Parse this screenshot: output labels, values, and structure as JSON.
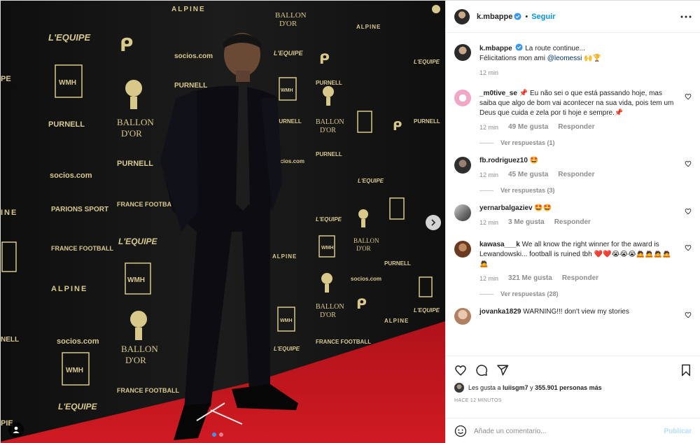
{
  "post": {
    "author": "k.mbappe",
    "verified": true,
    "follow_label": "Seguir",
    "separator": "•",
    "caption_line1": "La route continue...",
    "caption_line2_prefix": "Félicitations mon ami ",
    "caption_mention": "@leomessi",
    "caption_emoji": "🙌🏆",
    "caption_time": "12 min"
  },
  "photo": {
    "alt": "Ballon d'Or red carpet photo",
    "sponsors": [
      "L'EQUIPE",
      "WMH",
      "PURNELL",
      "BALLON D'OR",
      "FRANCE FOOTBALL",
      "socios.com",
      "ALPINE",
      "PARIONS SPORT"
    ],
    "carousel_dots": 2,
    "active_dot": 0
  },
  "comments": [
    {
      "user": "_m0tive_se",
      "prefix_emoji": "📌",
      "text": "Eu não sei o que está passando hoje, mas saiba que algo de bom vai acontecer na sua vida, pois tem um Deus que cuida e zela por ti hoje e sempre.",
      "suffix_emoji": "📌",
      "time": "12 min",
      "likes": "49 Me gusta",
      "reply": "Responder",
      "replies": "Ver respuestas (1)",
      "avatar_color": "#f4a6c8"
    },
    {
      "user": "fb.rodriguez10",
      "prefix_emoji": "",
      "text": "🤩",
      "suffix_emoji": "",
      "time": "12 min",
      "likes": "45 Me gusta",
      "reply": "Responder",
      "replies": "Ver respuestas (3)",
      "avatar_color": "#3a3a3a"
    },
    {
      "user": "yernarbalgaziev",
      "prefix_emoji": "",
      "text": "🤩🤩",
      "suffix_emoji": "",
      "time": "12 min",
      "likes": "3 Me gusta",
      "reply": "Responder",
      "replies": "",
      "avatar_color": "#7a7a7a"
    },
    {
      "user": "kawasa___k",
      "prefix_emoji": "",
      "text": "We all know the right winner for the award is Lewandowski... football is ruined tbh",
      "suffix_emoji": " ❤️❤️😭😭😭🙇🙇🙇🙇🙇",
      "time": "12 min",
      "likes": "321 Me gusta",
      "reply": "Responder",
      "replies": "Ver respuestas (28)",
      "avatar_color": "#8a5a3a"
    },
    {
      "user": "jovanka1829",
      "prefix_emoji": "",
      "text": "WARNING!!! don't view my stories",
      "suffix_emoji": "",
      "time": "",
      "likes": "",
      "reply": "",
      "replies": "",
      "avatar_color": "#d9b8a0"
    }
  ],
  "engagement": {
    "likes_prefix": "Les gusta a ",
    "likes_user": "luiisgm7",
    "likes_middle": " y ",
    "likes_count": "355.901 personas más",
    "timestamp": "HACE 12 MINUTOS"
  },
  "add_comment": {
    "placeholder": "Añade un comentario...",
    "publish_label": "Publicar"
  },
  "icons": {
    "more": "more-horizontal-icon",
    "heart": "heart-icon",
    "comment": "comment-icon",
    "share": "share-icon",
    "save": "bookmark-icon",
    "emoji": "emoji-icon",
    "next": "chevron-right-icon",
    "tag": "user-tag-icon"
  },
  "colors": {
    "link": "#0095f6",
    "verified": "#3897f0",
    "muted": "#8e8e8e",
    "carpet": "#c8141a",
    "backdrop": "#161616",
    "sponsor_gold": "#d8c98a"
  }
}
